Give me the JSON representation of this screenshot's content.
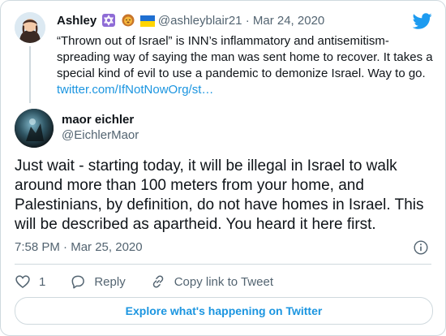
{
  "parent_tweet": {
    "name": "Ashley",
    "emojis": [
      "star-of-david-icon",
      "lion-face-icon",
      "ukraine-flag-icon"
    ],
    "handle": "@ashleyblair21",
    "separator": "·",
    "date": "Mar 24, 2020",
    "text": "“Thrown out of Israel” is INN’s inflammatory and antisemitism-spreading way of saying the man was sent home to recover. It takes a special kind of evil to use a pandemic to demonize Israel. Way to go.",
    "link": "twitter.com/IfNotNowOrg/st…"
  },
  "main_tweet": {
    "name": "maor eichler",
    "handle": "@EichlerMaor",
    "text": "Just wait - starting today, it will be illegal in Israel to walk around more than 100 meters from your home, and Palestinians, by definition, do not have homes in Israel. This will be described as apartheid. You heard it here first.",
    "time": "7:58 PM",
    "separator": "·",
    "date": "Mar 25, 2020"
  },
  "actions": {
    "like_count": "1",
    "reply_label": "Reply",
    "copy_link_label": "Copy link to Tweet"
  },
  "explore_label": "Explore what's happening on Twitter",
  "colors": {
    "twitter_blue": "#1d9bf0",
    "link_blue": "#1b95e0",
    "text": "#0f1419",
    "muted": "#536471",
    "border": "#cfd9de"
  }
}
